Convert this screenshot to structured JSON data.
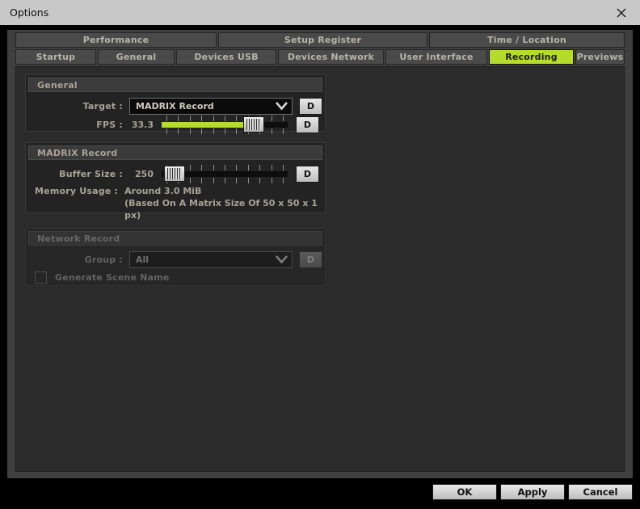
{
  "window": {
    "title": "Options",
    "close_icon": "close-icon"
  },
  "tabs": {
    "top_row": [
      {
        "label": "Performance",
        "active": false
      },
      {
        "label": "Setup Register",
        "active": false
      },
      {
        "label": "Time / Location",
        "active": false
      }
    ],
    "bottom_row": [
      {
        "label": "Startup",
        "active": false
      },
      {
        "label": "General",
        "active": false
      },
      {
        "label": "Devices USB",
        "active": false
      },
      {
        "label": "Devices Network",
        "active": false
      },
      {
        "label": "User Interface",
        "active": false
      },
      {
        "label": "Recording",
        "active": true
      },
      {
        "label": "Previews",
        "active": false
      }
    ],
    "active_tab_color": "#b5dc28"
  },
  "groups": {
    "general": {
      "title": "General",
      "target": {
        "label": "Target :",
        "value": "MADRIX Record",
        "dropdown_icon": "chevron-down-icon",
        "default_button": "D"
      },
      "fps": {
        "label": "FPS :",
        "value": "33.3",
        "fill_percent": 78,
        "default_button": "D"
      }
    },
    "madrix_record": {
      "title": "MADRIX Record",
      "buffer_size": {
        "label": "Buffer Size :",
        "value": "250",
        "fill_percent": 2,
        "default_button": "D"
      },
      "memory_usage": {
        "label": "Memory Usage :",
        "line1": "Around 3.0 MiB",
        "line2": "(Based On A Matrix Size Of 50 x 50 x 1 px)"
      }
    },
    "network_record": {
      "title": "Network Record",
      "disabled": true,
      "group_field": {
        "label": "Group :",
        "value": "All",
        "dropdown_icon": "chevron-down-icon",
        "default_button": "D"
      },
      "generate_scene_name": {
        "label": "Generate Scene Name",
        "checked": false
      }
    }
  },
  "footer": {
    "ok": "OK",
    "apply": "Apply",
    "cancel": "Cancel"
  }
}
